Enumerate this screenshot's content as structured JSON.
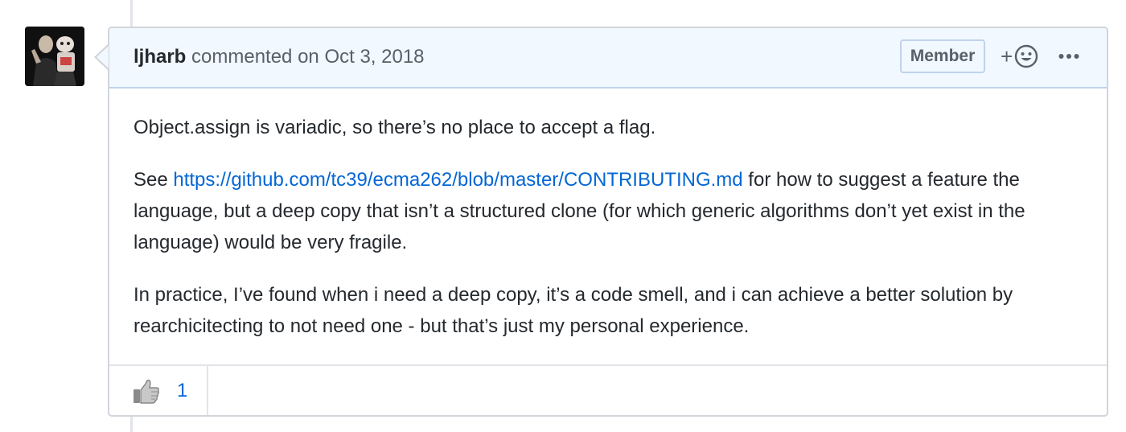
{
  "comment": {
    "author": "ljharb",
    "action": "commented on",
    "date": "Oct 3, 2018",
    "badge": "Member",
    "add_reaction_label": "+",
    "paragraphs": {
      "p1": "Object.assign is variadic, so there’s no place to accept a flag.",
      "p2_prefix": "See ",
      "p2_link": "https://github.com/tc39/ecma262/blob/master/CONTRIBUTING.md",
      "p2_suffix": " for how to suggest a feature the language, but a deep copy that isn’t a structured clone (for which generic algorithms don’t yet exist in the language) would be very fragile.",
      "p3": "In practice, I’ve found when i need a deep copy, it’s a code smell, and i can achieve a better solution by rearchicitecting to not need one - but that’s just my personal experience."
    },
    "reactions": [
      {
        "icon": "thumbs-up-icon",
        "count": "1"
      }
    ]
  },
  "colors": {
    "header_bg": "#f1f8ff",
    "link": "#0366d6",
    "border": "#d1d5da"
  }
}
